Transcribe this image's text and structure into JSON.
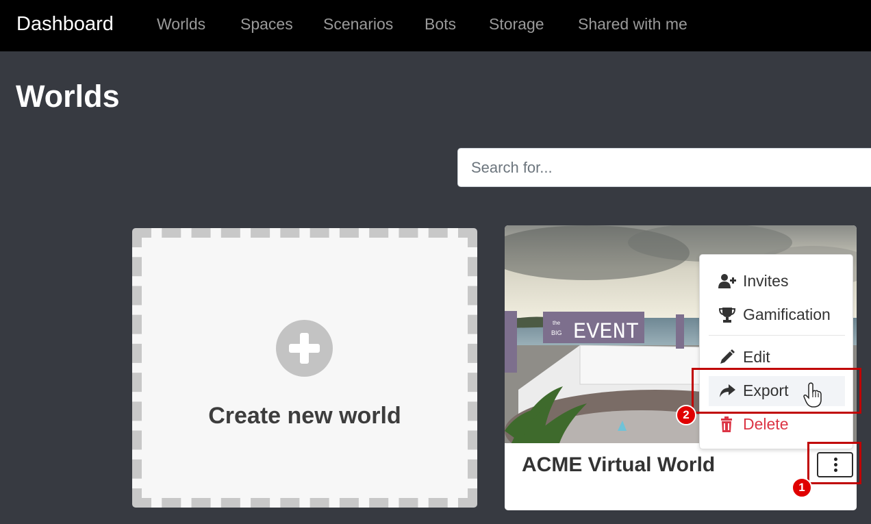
{
  "navbar": {
    "brand": "Dashboard",
    "links": [
      "Worlds",
      "Spaces",
      "Scenarios",
      "Bots",
      "Storage",
      "Shared with me"
    ]
  },
  "page": {
    "title": "Worlds"
  },
  "search": {
    "placeholder": "Search for..."
  },
  "create_card": {
    "label": "Create new world",
    "icon": "plus-circle-icon"
  },
  "world_card": {
    "name": "ACME Virtual World",
    "thumbnail_sign": {
      "small_text_1": "the",
      "small_text_2": "BIG",
      "main_text": "EVENT"
    }
  },
  "dropdown": {
    "items": [
      {
        "label": "Invites",
        "icon": "user-plus-icon"
      },
      {
        "label": "Gamification",
        "icon": "trophy-icon"
      },
      {
        "label": "Edit",
        "icon": "pencil-icon"
      },
      {
        "label": "Export",
        "icon": "share-arrow-icon"
      },
      {
        "label": "Delete",
        "icon": "trash-icon"
      }
    ]
  },
  "annotations": {
    "step_1": "1",
    "step_2": "2"
  },
  "colors": {
    "navbar": "#000000",
    "background": "#373a41",
    "danger": "#dc3545",
    "callout": "#c00000"
  }
}
